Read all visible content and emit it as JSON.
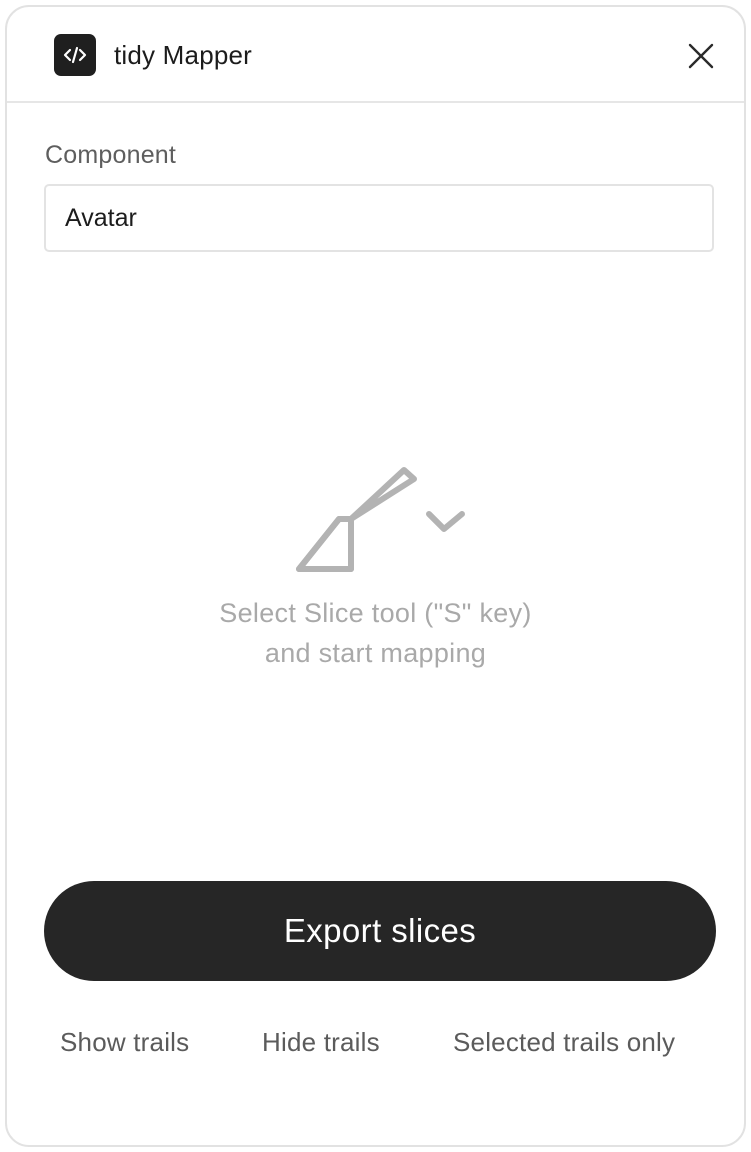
{
  "header": {
    "app_icon": "code-brackets-icon",
    "title": "tidy Mapper",
    "close_icon": "close-icon"
  },
  "component_field": {
    "label": "Component",
    "value": "Avatar"
  },
  "empty_state": {
    "icon": "slice-tool-icon",
    "line1": "Select Slice tool (\"S\" key)",
    "line2": "and start mapping"
  },
  "actions": {
    "export_label": "Export slices"
  },
  "trail_options": {
    "show": "Show trails",
    "hide": "Hide trails",
    "selected": "Selected trails only"
  },
  "colors": {
    "primary_button": "#262626",
    "muted_text": "#a9a9a9",
    "border": "#e3e3e3"
  }
}
